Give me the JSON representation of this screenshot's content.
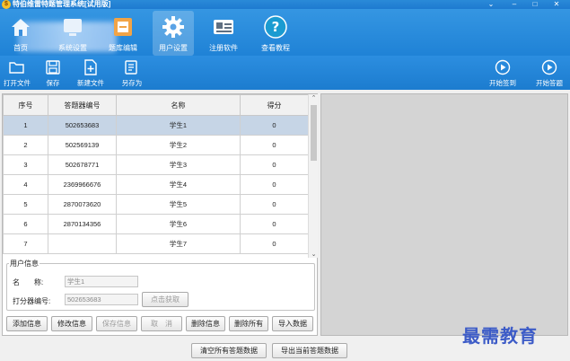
{
  "window": {
    "title": "特伯维雷特题管理系统[试用版]",
    "controls": [
      "⌄",
      "–",
      "□",
      "✕"
    ]
  },
  "nav": {
    "items": [
      {
        "label": "首页",
        "icon": "home-icon"
      },
      {
        "label": "系统设置",
        "icon": "system-settings-icon"
      },
      {
        "label": "题库编辑",
        "icon": "question-bank-icon"
      },
      {
        "label": "用户设置",
        "icon": "gear-icon",
        "active": true
      },
      {
        "label": "注册软件",
        "icon": "register-icon"
      },
      {
        "label": "查看教程",
        "icon": "help-icon"
      }
    ]
  },
  "toolbar": {
    "open": "打开文件",
    "save": "保存",
    "new": "新建文件",
    "save_as": "另存为",
    "start_signin": "开始签到",
    "start_answer": "开始答题"
  },
  "table": {
    "columns": [
      "序号",
      "答题器编号",
      "名称",
      "得分"
    ],
    "rows": [
      {
        "no": "1",
        "device": "502653683",
        "name": "学生1",
        "score": "0"
      },
      {
        "no": "2",
        "device": "502569139",
        "name": "学生2",
        "score": "0"
      },
      {
        "no": "3",
        "device": "502678771",
        "name": "学生3",
        "score": "0"
      },
      {
        "no": "4",
        "device": "2369966676",
        "name": "学生4",
        "score": "0"
      },
      {
        "no": "5",
        "device": "2870073620",
        "name": "学生5",
        "score": "0"
      },
      {
        "no": "6",
        "device": "2870134356",
        "name": "学生6",
        "score": "0"
      },
      {
        "no": "7",
        "device": "",
        "name": "学生7",
        "score": "0"
      }
    ]
  },
  "user_info": {
    "legend": "用户信息",
    "name_label": "名　　称:",
    "name_value": "学生1",
    "device_label": "打分器编号:",
    "device_value": "502653683",
    "fetch_button": "点击获取"
  },
  "actions": {
    "add": "添加信息",
    "edit": "修改信息",
    "save": "保存信息",
    "cancel": "取　消",
    "delete": "删除信息",
    "delete_all": "删除所有",
    "import": "导入数据"
  },
  "bottom": {
    "clear": "清空所有答题数据",
    "export": "导出当前答题数据"
  },
  "watermark": "最需教育"
}
